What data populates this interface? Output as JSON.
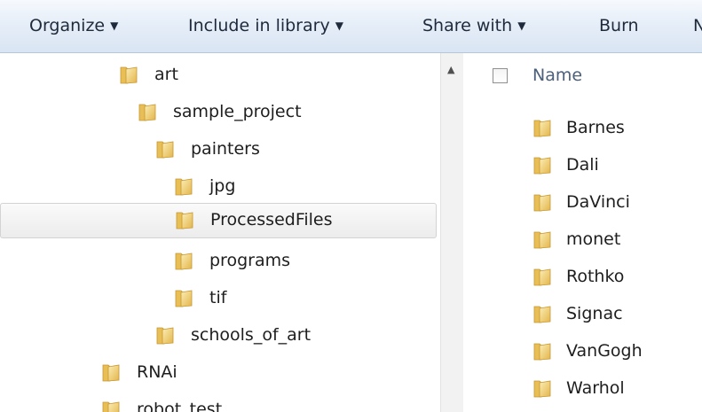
{
  "toolbar": {
    "organize": "Organize",
    "include_in_library": "Include in library",
    "share_with": "Share with",
    "burn": "Burn",
    "cut_label": "N",
    "dropdown_glyph": "▼"
  },
  "nav": {
    "items": [
      {
        "label": "art"
      },
      {
        "label": "sample_project"
      },
      {
        "label": "painters"
      },
      {
        "label": "jpg"
      },
      {
        "label": "ProcessedFiles"
      },
      {
        "label": "programs"
      },
      {
        "label": "tif"
      },
      {
        "label": "schools_of_art"
      },
      {
        "label": "RNAi"
      },
      {
        "label": "robot_test"
      }
    ],
    "selected_label": "ProcessedFiles"
  },
  "scrollbar": {
    "up_glyph": "▲"
  },
  "content": {
    "column_name": "Name",
    "files": [
      {
        "label": "Barnes"
      },
      {
        "label": "Dali"
      },
      {
        "label": "DaVinci"
      },
      {
        "label": "monet"
      },
      {
        "label": "Rothko"
      },
      {
        "label": "Signac"
      },
      {
        "label": "VanGogh"
      },
      {
        "label": "Warhol"
      }
    ]
  },
  "colors": {
    "folder_light": "#f7e29a",
    "folder_dark": "#d7a93d",
    "toolbar_top": "#f6f9fd",
    "toolbar_bottom": "#d9e5f3"
  }
}
